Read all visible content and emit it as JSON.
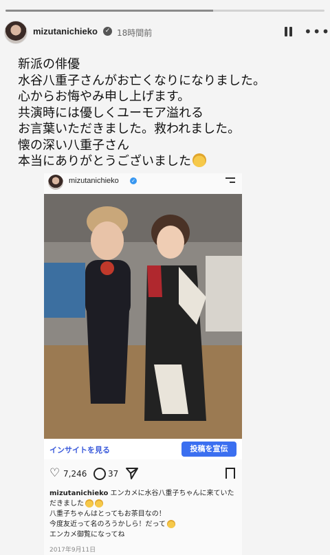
{
  "story": {
    "progress": 0.65,
    "username": "mizutanichieko",
    "timestamp": "18時間前",
    "pause_icon": "pause-icon",
    "more_icon": "more-icon",
    "message_lines": [
      "新派の俳優",
      "水谷八重子さんがお亡くなりになりました。",
      "心からお悔やみ申し上げます。",
      "共演時には優しくユーモア溢れる",
      "お言葉いただきました。救われました。",
      "懐の深い八重子さん",
      "本当にありがとうございました"
    ]
  },
  "post": {
    "username": "mizutanichieko",
    "insight_link": "インサイトを見る",
    "promote_button": "投稿を宣伝",
    "likes": "7,246",
    "comments": "37",
    "caption_user": "mizutanichieko",
    "caption_text": " エンカメに水谷八重子ちゃんに来ていただきました",
    "caption_line2": "八重子ちゃんはとってもお茶目なの！",
    "caption_line3": "今度友近って名のろうかしら！だって",
    "caption_line4": "エンカメ御覧になってね",
    "date": "2017年9月11日"
  },
  "colors": {
    "accent": "#3b6ff0",
    "link": "#3b5bdb",
    "verified": "#3897f0"
  }
}
